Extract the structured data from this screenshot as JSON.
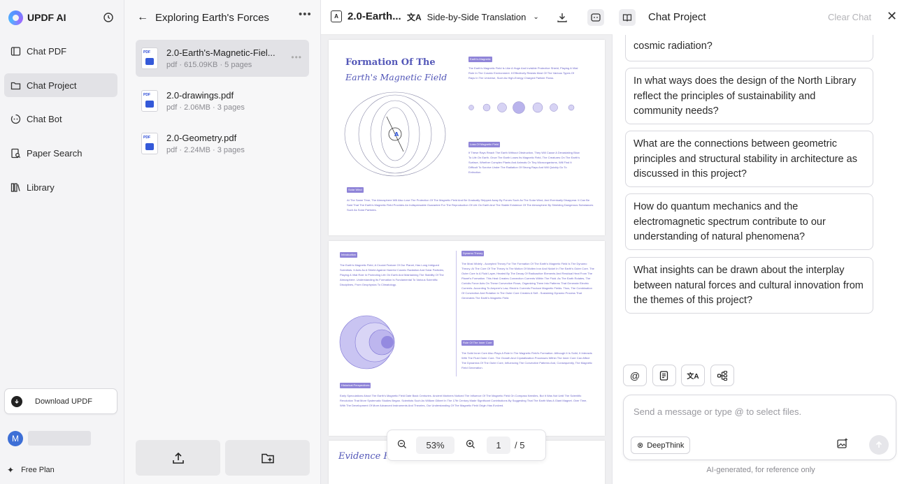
{
  "app": {
    "name": "UPDF AI"
  },
  "sidebar": {
    "items": [
      {
        "label": "Chat PDF",
        "icon": "chat-pdf-icon"
      },
      {
        "label": "Chat Project",
        "icon": "folder-icon",
        "active": true
      },
      {
        "label": "Chat Bot",
        "icon": "bot-icon"
      },
      {
        "label": "Paper Search",
        "icon": "paper-search-icon"
      },
      {
        "label": "Library",
        "icon": "library-icon"
      }
    ],
    "download_label": "Download UPDF",
    "avatar_initial": "M",
    "plan_label": "Free Plan"
  },
  "project": {
    "title": "Exploring Earth's Forces",
    "files": [
      {
        "name": "2.0-Earth's-Magnetic-Fiel...",
        "meta": "pdf · 615.09KB · 5 pages"
      },
      {
        "name": "2.0-drawings.pdf",
        "meta": "pdf · 2.06MB · 3 pages"
      },
      {
        "name": "2.0-Geometry.pdf",
        "meta": "pdf · 2.24MB · 3 pages"
      }
    ]
  },
  "viewer": {
    "doc_title": "2.0-Earth...",
    "mode_label": "Side-by-Side Translation",
    "zoom": "53%",
    "page_current": "1",
    "page_total": "/ 5",
    "page1": {
      "title_line1": "Formation Of The",
      "title_line2": "Earth's Magnetic Field",
      "pill1": "Earth's Magnetic",
      "pill2": "Loss Of Magnetic Field",
      "pill3": "Solar Wind",
      "text1": "The Earth's Magnetic Field Is Like A Huge And Invisible Protective Shield, Playing A Vital Role In The Cosmic Environment. It Effectively Resists Most Of The Various Types Of Rays In The Universe, Such As High-Energy Charged Particle Flows.",
      "text2": "If These Rays Reach The Earth Without Obstruction, They Will Cause A Devastating Blow To Life On Earth. Once The Earth Loses Its Magnetic Field, The Creatures On The Earth's Surface, Whether Complex Plants And Animals Or Tiny Microorganisms, Will Find It Difficult To Survive Under The Radiation Of Strong Rays And Will Quickly Go To Extinction.",
      "text3": "At The Same Time, The Atmosphere Will Also Lose The Protection Of The Magnetic Field And Be Gradually Stripped Away By Forces Such As The Solar Wind, And Eventually Disappear. It Can Be Said That The Earth's Magnetic Field Provides An Indispensable Guarantee For The Reproduction Of Life On Earth And The Stable Existence Of The Atmosphere By Shielding Dangerous Substances Such As Solar Particles.",
      "planet_labels": [
        "Mercury",
        "Venus",
        "Earth",
        "Mars",
        "Jupiter",
        "Saturn",
        "Uranus",
        "Neptune"
      ]
    },
    "page2": {
      "pill1": "Introduction",
      "pill2": "Dynamo Theory",
      "pill3": "Role Of The Inner Core",
      "pill4": "Historical Perspectives",
      "text1": "The Earth's Magnetic Field, A Crucial Feature Of Our Planet, Has Long Intrigued Scientists. It Acts As A Shield Against Harmful Cosmic Radiation And Solar Particles, Playing A Vital Role In Protecting Life On Earth And Maintaining The Stability Of The Atmosphere. Understanding Its Formation Is Fundamental To Various Scientific Disciplines, From Geophysics To Climatology.",
      "text2": "The Most Widely - Accepted Theory For The Formation Of The Earth's Magnetic Field Is The Dynamo Theory. At The Core Of The Theory Is The Motion Of Molten Iron And Nickel In The Earth's Outer Core. The Outer Core Is A Fluid Layer, Heated By The Decay Of Radioactive Elements And Residual Heat From The Planet's Formation. This Heat Creates Convection Currents Within The Fluid. As The Earth Rotates, The Coriolis Force Acts On These Convective Flows, Organizing Them Into Patterns That Generate Electric Currents. According To Ampere's Law, Electric Currents Produce Magnetic Fields. Thus, The Combination Of Convection And Rotation In The Outer Core Creates A Self - Sustaining Dynamo Process That Generates The Earth's Magnetic Field.",
      "text3": "The Solid Inner Core Also Plays A Role In The Magnetic Field's Formation. Although It Is Solid, It Interacts With The Fluid Outer Core. The Growth And Crystallization Processes Within The Inner Core Can Affect The Dynamics Of The Outer Core, Influencing The Convective Patterns And, Consequently, The Magnetic Field Generation.",
      "text4": "Early Speculations About The Earth's Magnetic Field Date Back Centuries. Ancient Mariners Noticed The Influence Of The Magnetic Field On Compass Needles, But It Was Not Until The Scientific Revolution That More Systematic Studies Began. Scientists Such As William Gilbert In The 17th Century Made Significant Contributions By Suggesting That The Earth Was A Giant Magnet. Over Time, With The Development Of More Advanced Instruments And Theories, Our Understanding Of The Magnetic Field Origin Has Evolved."
    },
    "page3": {
      "title": "Evidence Fo"
    }
  },
  "chat": {
    "title": "Chat Project",
    "clear_label": "Clear Chat",
    "questions": [
      "cosmic radiation?",
      "In what ways does the design of the North Library reflect the principles of sustainability and community needs?",
      "What are the connections between geometric principles and structural stability in architecture as discussed in this project?",
      "How do quantum mechanics and the electromagnetic spectrum contribute to our understanding of natural phenomena?",
      "What insights can be drawn about the interplay between natural forces and cultural innovation from the themes of this project?"
    ],
    "tools": [
      "@"
    ],
    "input_placeholder": "Send a message or type @ to select files.",
    "deepthink_label": "DeepThink",
    "disclaimer": "AI-generated, for reference only"
  },
  "colors": {
    "accent": "#3459d9",
    "doc_purple": "#5357b8",
    "pill": "#8f84d8"
  }
}
